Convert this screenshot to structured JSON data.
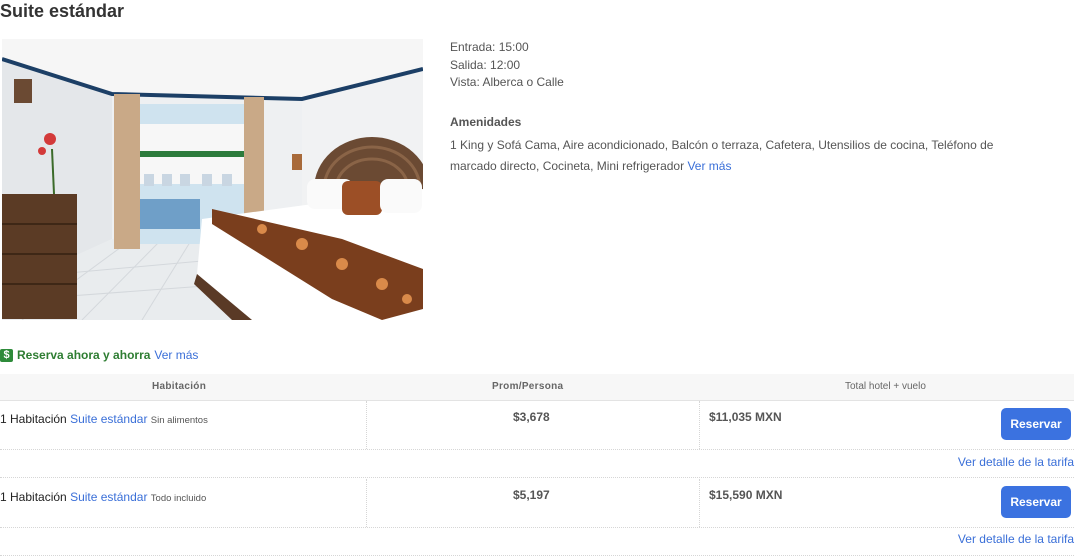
{
  "room": {
    "title": "Suite estándar",
    "checkin": "Entrada: 15:00",
    "checkout": "Salida: 12:00",
    "view": "Vista: Alberca o Calle",
    "amenities_title": "Amenidades",
    "amenities": "1 King y Sofá Cama, Aire acondicionado, Balcón o terraza, Cafetera, Utensilios de cocina, Teléfono de marcado directo, Cocineta, Mini refrigerador",
    "amenities_more": "Ver más"
  },
  "promo": {
    "icon": "dollar-icon",
    "text": "Reserva ahora y ahorra",
    "more": "Ver más"
  },
  "table": {
    "headers": [
      "Habitación",
      "Prom/Persona",
      "Total hotel + vuelo"
    ],
    "rows": [
      {
        "count": "1 Habitación",
        "room_link": "Suite estándar",
        "plan": "Sin alimentos",
        "per_person": "$3,678",
        "total": "$11,035 MXN",
        "button": "Reservar",
        "detail": "Ver detalle de la tarifa"
      },
      {
        "count": "1 Habitación",
        "room_link": "Suite estándar",
        "plan": "Todo incluido",
        "per_person": "$5,197",
        "total": "$15,590 MXN",
        "button": "Reservar",
        "detail": "Ver detalle de la tarifa"
      }
    ]
  },
  "colors": {
    "link": "#3a6fd8",
    "button": "#3b72e0",
    "promo": "#2e7d32"
  }
}
